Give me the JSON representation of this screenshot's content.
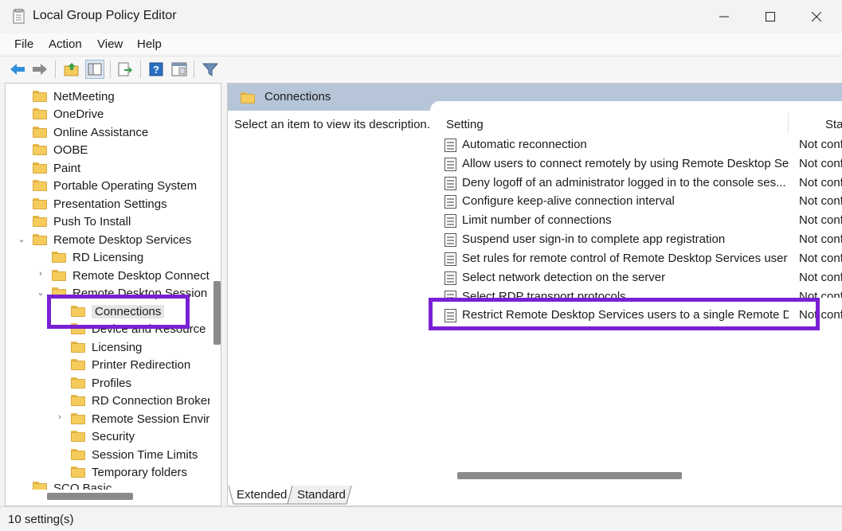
{
  "window": {
    "title": "Local Group Policy Editor"
  },
  "menu": [
    "File",
    "Action",
    "View",
    "Help"
  ],
  "toolbar": {
    "icons": [
      "back-arrow-icon",
      "forward-arrow-icon",
      "up-folder-icon",
      "show-hide-tree-icon",
      "export-list-icon",
      "help-icon",
      "properties-icon",
      "filter-icon"
    ]
  },
  "tree": {
    "items": [
      {
        "label": "NetMeeting"
      },
      {
        "label": "OneDrive"
      },
      {
        "label": "Online Assistance"
      },
      {
        "label": "OOBE"
      },
      {
        "label": "Paint"
      },
      {
        "label": "Portable Operating System"
      },
      {
        "label": "Presentation Settings"
      },
      {
        "label": "Push To Install"
      },
      {
        "label": "Remote Desktop Services"
      },
      {
        "label": "RD Licensing"
      },
      {
        "label": "Remote Desktop Connect"
      },
      {
        "label": "Remote Desktop Session I"
      },
      {
        "label": "Connections"
      },
      {
        "label": "Device and Resource R"
      },
      {
        "label": "Licensing"
      },
      {
        "label": "Printer Redirection"
      },
      {
        "label": "Profiles"
      },
      {
        "label": "RD Connection Broker"
      },
      {
        "label": "Remote Session Enviro"
      },
      {
        "label": "Security"
      },
      {
        "label": "Session Time Limits"
      },
      {
        "label": "Temporary folders"
      },
      {
        "label": "SCO Basic"
      }
    ]
  },
  "details": {
    "header": "Connections",
    "description": "Select an item to view its description.",
    "columns": {
      "setting": "Setting",
      "state": "State"
    },
    "rows": [
      {
        "setting": "Automatic reconnection",
        "state": "Not configured"
      },
      {
        "setting": "Allow users to connect remotely by using Remote Desktop Se...",
        "state": "Not configured"
      },
      {
        "setting": "Deny logoff of an administrator logged in to the console ses...",
        "state": "Not configured"
      },
      {
        "setting": "Configure keep-alive connection interval",
        "state": "Not configured"
      },
      {
        "setting": "Limit number of connections",
        "state": "Not configured"
      },
      {
        "setting": "Suspend user sign-in to complete app registration",
        "state": "Not configured"
      },
      {
        "setting": "Set rules for remote control of Remote Desktop Services user ...",
        "state": "Not configured"
      },
      {
        "setting": "Select network detection on the server",
        "state": "Not configured"
      },
      {
        "setting": "Select RDP transport protocols",
        "state": "Not configured"
      },
      {
        "setting": "Restrict Remote Desktop Services users to a single Remote De...",
        "state": "Not configured"
      }
    ]
  },
  "tabs": [
    "Extended",
    "Standard"
  ],
  "status": "10 setting(s)",
  "colors": {
    "highlight": "#7a20d4",
    "header_bg": "#b6c6d8",
    "folder": "#f5cc5c"
  }
}
